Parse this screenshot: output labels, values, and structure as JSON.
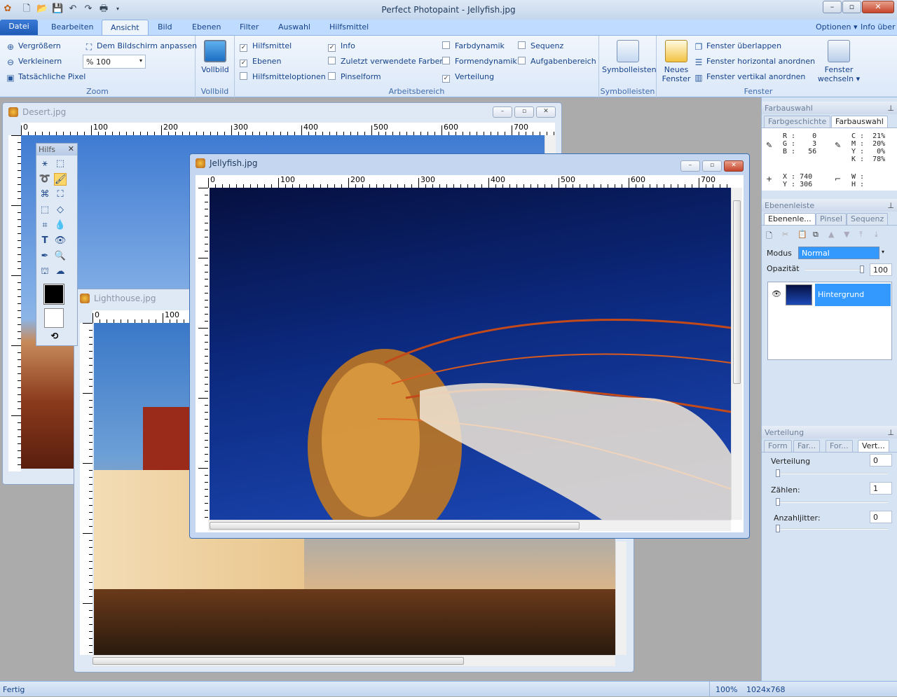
{
  "app": {
    "title": "Perfect Photopaint - Jellyfish.jpg",
    "options": "Optionen",
    "info": "Info über"
  },
  "tabs": [
    "Datei",
    "Bearbeiten",
    "Ansicht",
    "Bild",
    "Ebenen",
    "Filter",
    "Auswahl",
    "Hilfsmittel"
  ],
  "ribbon": {
    "zoom": {
      "enlarge": "Vergrößern",
      "shrink": "Verkleinern",
      "actual": "Tatsächliche Pixel",
      "fit": "Dem Bildschirm anpassen",
      "value": "% 100",
      "label": "Zoom"
    },
    "fullscreen": {
      "button": "Vollbild",
      "label": "Vollbild"
    },
    "workspace": {
      "items": [
        {
          "label": "Hilfsmittel",
          "checked": true
        },
        {
          "label": "Ebenen",
          "checked": true
        },
        {
          "label": "Hilfsmitteloptionen",
          "checked": false
        },
        {
          "label": "Info",
          "checked": true
        },
        {
          "label": "Zuletzt verwendete Farben",
          "checked": false
        },
        {
          "label": "Pinselform",
          "checked": false
        },
        {
          "label": "Farbdynamik",
          "checked": false
        },
        {
          "label": "Formendynamik",
          "checked": false
        },
        {
          "label": "Verteilung",
          "checked": true
        },
        {
          "label": "Sequenz",
          "checked": false
        },
        {
          "label": "Aufgabenbereich",
          "checked": false
        }
      ],
      "label": "Arbeitsbereich"
    },
    "toolbars": {
      "button": "Symbolleisten",
      "label": "Symbolleisten"
    },
    "window": {
      "new_line1": "Neues",
      "new_line2": "Fenster",
      "cascade": "Fenster überlappen",
      "tile_h": "Fenster horizontal anordnen",
      "tile_v": "Fenster vertikal anordnen",
      "switch_line1": "Fenster",
      "switch_line2": "wechseln",
      "label": "Fenster"
    }
  },
  "windows": {
    "desert": {
      "title": "Desert.jpg",
      "ruler_h": [
        "0",
        "100",
        "200",
        "300",
        "400",
        "500",
        "600",
        "700"
      ]
    },
    "lighthouse": {
      "title": "Lighthouse.jpg",
      "ruler_h": [
        "0",
        "100"
      ]
    },
    "jellyfish": {
      "title": "Jellyfish.jpg",
      "ruler_h": [
        "0",
        "100",
        "200",
        "300",
        "400",
        "500",
        "600",
        "700"
      ]
    }
  },
  "toolbox": {
    "title": "Hilfs"
  },
  "panels": {
    "color": {
      "title": "Farbauswahl",
      "tabs": [
        "Farbgeschichte",
        "Farbauswahl"
      ],
      "rgb": "R :    0\nG :    3\nB :   56",
      "cmyk": "C :  21%\nM :  20%\nY :   0%\nK :  78%",
      "xy": "X : 740\nY : 306",
      "wh": "W :\nH :"
    },
    "layers": {
      "title": "Ebenenleiste",
      "tabs": [
        "Ebenenle...",
        "Pinsel",
        "Sequenz"
      ],
      "mode_label": "Modus",
      "mode_value": "Normal",
      "opacity_label": "Opazität",
      "opacity_value": "100",
      "opacity": 100,
      "layer_name": "Hintergrund"
    },
    "distribution": {
      "title": "Verteilung",
      "tabs": [
        "Form",
        "Far...",
        "For...",
        "Vert..."
      ],
      "items": [
        {
          "label": "Verteilung",
          "value": "0"
        },
        {
          "label": "Zählen:",
          "value": "1"
        },
        {
          "label": "Anzahljitter:",
          "value": "0"
        }
      ]
    }
  },
  "status": {
    "text": "Fertig",
    "zoom": "100%",
    "size": "1024x768"
  }
}
